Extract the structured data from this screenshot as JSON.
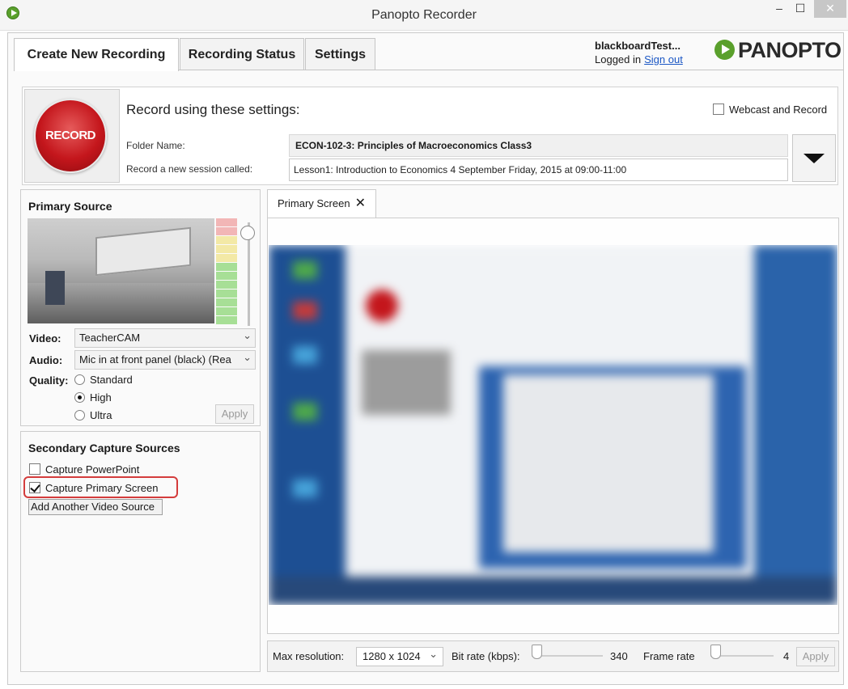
{
  "window": {
    "title": "Panopto Recorder",
    "controls": {
      "minimize": "–",
      "maximize": "☐",
      "close": "✕"
    }
  },
  "tabs": [
    {
      "label": "Create New Recording",
      "active": true
    },
    {
      "label": "Recording Status",
      "active": false
    },
    {
      "label": "Settings",
      "active": false
    }
  ],
  "user": {
    "name": "blackboardTest...",
    "status": "Logged in",
    "sign_out": "Sign out"
  },
  "logo": {
    "text": "PANOPTO",
    "color": "#5aa02c"
  },
  "record": {
    "button_label": "RECORD",
    "heading": "Record using these settings:",
    "webcast_label": "Webcast and Record",
    "webcast_checked": false,
    "folder_label": "Folder Name:",
    "folder_value": "ECON-102-3: Principles of Macroeconomics Class3",
    "session_label": "Record a new session called:",
    "session_value": "Lesson1: Introduction to Economics 4 September Friday,  2015 at 09:00-11:00",
    "button_color": "#c4161c"
  },
  "primary_source": {
    "title": "Primary Source",
    "video_label": "Video:",
    "video_value": "TeacherCAM",
    "audio_label": "Audio:",
    "audio_value": "Mic in at front panel (black) (Rea",
    "quality_label": "Quality:",
    "quality_options": [
      {
        "label": "Standard",
        "selected": false
      },
      {
        "label": "High",
        "selected": true
      },
      {
        "label": "Ultra",
        "selected": false
      }
    ],
    "apply_label": "Apply"
  },
  "secondary_sources": {
    "title": "Secondary Capture Sources",
    "items": [
      {
        "label": "Capture PowerPoint",
        "checked": false
      },
      {
        "label": "Capture Primary Screen",
        "checked": true
      }
    ],
    "add_label": "Add Another Video Source",
    "highlight_color": "#d43c3c"
  },
  "preview": {
    "tab_label": "Primary Screen",
    "close_glyph": "✕"
  },
  "capture_settings": {
    "max_resolution_label": "Max resolution:",
    "max_resolution_value": "1280 x 1024",
    "bitrate_label": "Bit rate (kbps):",
    "bitrate_value": "340",
    "framerate_label": "Frame rate",
    "framerate_value": "4",
    "apply_label": "Apply"
  }
}
